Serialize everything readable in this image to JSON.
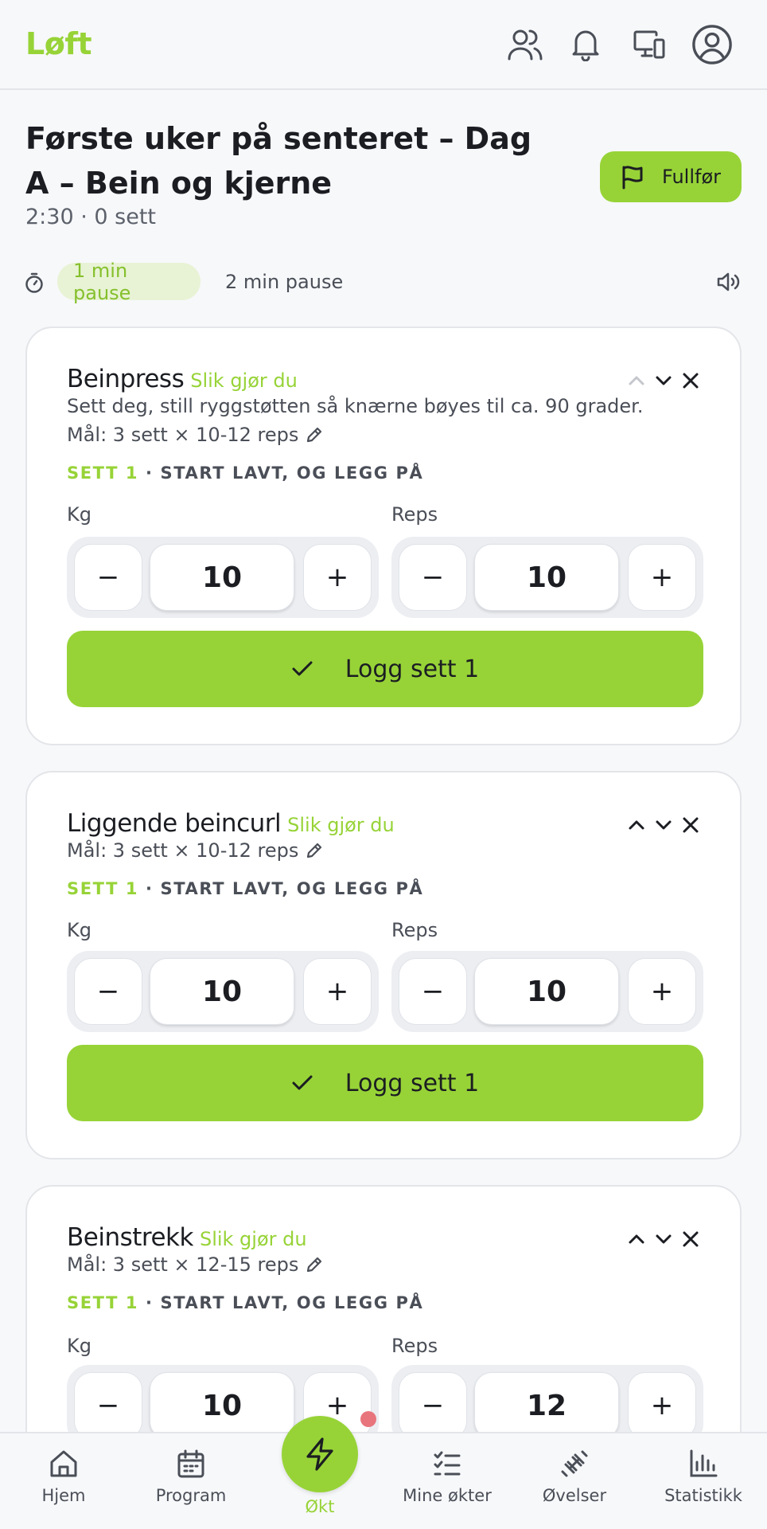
{
  "app": {
    "logo": "Løft"
  },
  "header": {
    "icons": [
      "users-icon",
      "bell-icon",
      "devices-icon",
      "account-icon"
    ]
  },
  "session": {
    "title": "Første uker på senteret – Dag A – Bein og kjerne",
    "meta": "2:30 · 0 sett",
    "finish_label": "Fullfør"
  },
  "rest": {
    "options": [
      "1 min pause",
      "2 min pause"
    ],
    "selected": "1 min pause"
  },
  "labels": {
    "kg": "Kg",
    "reps": "Reps",
    "howto": "Slik gjør du"
  },
  "exercises": [
    {
      "name": "Beinpress",
      "description": "Sett deg, still ryggstøtten så knærne bøyes til ca. 90 grader.",
      "goal": "Mål: 3 sett × 10-12 reps",
      "set_label": "SETT 1",
      "set_hint": " · START LAVT, OG LEGG PÅ",
      "kg": "10",
      "reps": "10",
      "log_label": "Logg sett 1"
    },
    {
      "name": "Liggende beincurl",
      "goal": "Mål: 3 sett × 10-12 reps",
      "set_label": "SETT 1",
      "set_hint": " · START LAVT, OG LEGG PÅ",
      "kg": "10",
      "reps": "10",
      "log_label": "Logg sett 1"
    },
    {
      "name": "Beinstrekk",
      "goal": "Mål: 3 sett × 12-15 reps",
      "set_label": "SETT 1",
      "set_hint": " · START LAVT, OG LEGG PÅ",
      "kg": "10",
      "reps": "12"
    }
  ],
  "nav": {
    "items": [
      {
        "label": "Hjem",
        "icon": "home-icon"
      },
      {
        "label": "Program",
        "icon": "calendar-icon"
      },
      {
        "label": "Økt",
        "icon": "bolt-icon",
        "active": true
      },
      {
        "label": "Mine økter",
        "icon": "checklist-icon"
      },
      {
        "label": "Øvelser",
        "icon": "dumbbell-icon"
      },
      {
        "label": "Statistikk",
        "icon": "bar-chart-icon"
      }
    ]
  },
  "colors": {
    "accent": "#97d337",
    "accent_soft": "#e8f3d5",
    "badge": "#e8757c"
  }
}
